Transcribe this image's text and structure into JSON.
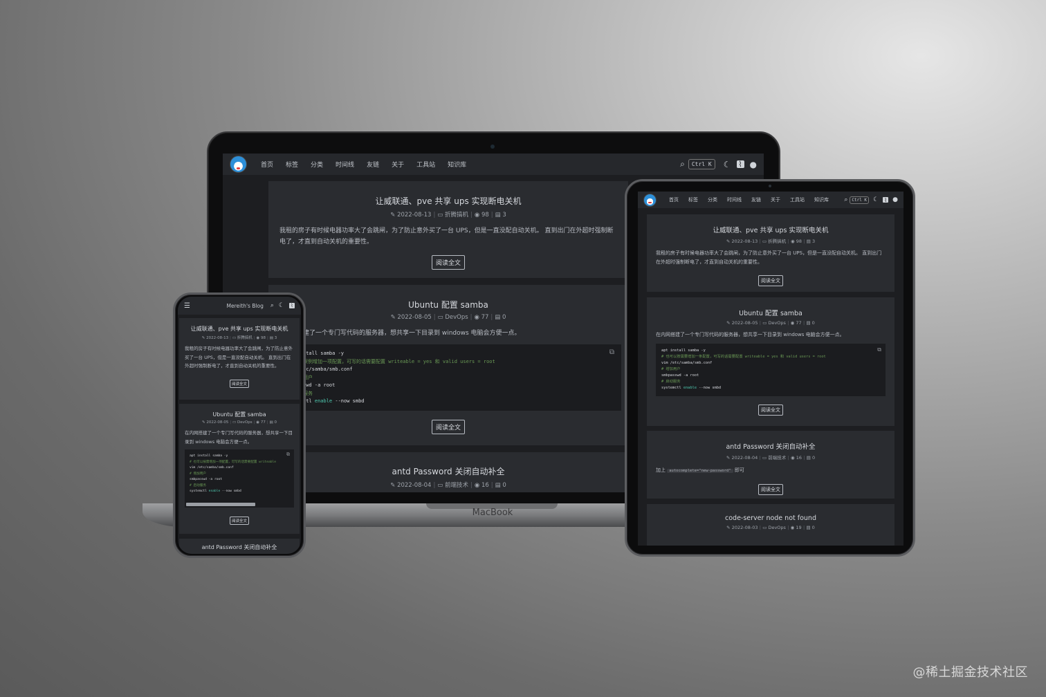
{
  "nav": {
    "items": [
      "首页",
      "标签",
      "分类",
      "时间线",
      "友链",
      "关于",
      "工具站",
      "知识库"
    ],
    "search_shortcut": "Ctrl K"
  },
  "phone_nav": {
    "site_title": "Mereith's Blog"
  },
  "posts": [
    {
      "title": "让威联通、pve 共享 ups 实现断电关机",
      "date": "2022-08-13",
      "category": "折腾搞机",
      "views": "98",
      "comments": "3",
      "excerpt": "我租的房子有时候电器功率大了会跳闸，为了防止意外买了一台 UPS，但是一直没配自动关机。 直到出门在外超时强制断电了，才直到自动关机的重要性。",
      "read_more": "阅读全文"
    },
    {
      "title": "Ubuntu 配置 samba",
      "date": "2022-08-05",
      "category": "DevOps",
      "views": "77",
      "comments": "0",
      "excerpt": "在内网搭建了一个专门写代码的服务器，想共享一下目录到 windows 电脑会方便一点。",
      "excerpt_laptop_visible": "建了一个专门写代码的服务器，想共享一下目录到 windows 电脑会方便一点。",
      "code": {
        "line1": "apt install samba -y",
        "line2": "# 也可以按需要增加一条配置，可写的话需要配置 writeable = yes 和 valid users = root",
        "line3": "vim /etc/samba/smb.conf",
        "line4": "# 增加用户",
        "line5": "smbpasswd -a root",
        "line6": "# 启动服务",
        "line7a": "systemctl ",
        "line7b": "enable",
        "line7c": " --now smbd"
      },
      "code_laptop": {
        "line1": "stall samba -y",
        "line2": "案例增加一项配置，可写的话需要配置 writeable = yes 和 valid users = root",
        "line3": "tc/samba/smb.conf",
        "line4": "用户",
        "line5": "swd -a root",
        "line6": "服务",
        "line7a": "ctl ",
        "line7b": "enable",
        "line7c": " --now smbd"
      },
      "code_phone": {
        "line1": "apt install samba -y",
        "line2": "# 也可以按需增加一项配置，可写的话需要配置 writeable",
        "line3": "vim /etc/samba/smb.conf",
        "line4": "# 增加用户",
        "line5": "smbpasswd -a root",
        "line6": "# 启动服务",
        "line7a": "systemctl ",
        "line7b": "enable",
        "line7c": " --now smbd"
      },
      "read_more": "阅读全文"
    },
    {
      "title": "antd Password 关闭自动补全",
      "date": "2022-08-04",
      "category": "前端技术",
      "views": "16",
      "comments": "0",
      "excerpt_prefix": "加上",
      "excerpt_code": "autocomplete=\"new-password\"",
      "excerpt_suffix": "即可",
      "read_more": "阅读全文"
    },
    {
      "title": "code-server node not found",
      "date": "2022-08-03",
      "category": "DevOps",
      "views": "19",
      "comments": "0"
    }
  ],
  "device": {
    "laptop_brand": "MacBook"
  },
  "watermark": "@稀土掘金技术社区",
  "colors": {
    "page_bg": "#1d1e21",
    "card_bg": "#2a2c30",
    "nav_bg": "#26282c",
    "code_bg": "#1b1c1f",
    "code_comment": "#6a9955",
    "code_keyword": "#4ec9b0"
  },
  "icons": [
    "menu-icon",
    "search-icon",
    "moon-icon",
    "rss-icon",
    "user-icon",
    "edit-icon",
    "folder-icon",
    "eye-icon",
    "comment-icon",
    "copy-icon"
  ]
}
